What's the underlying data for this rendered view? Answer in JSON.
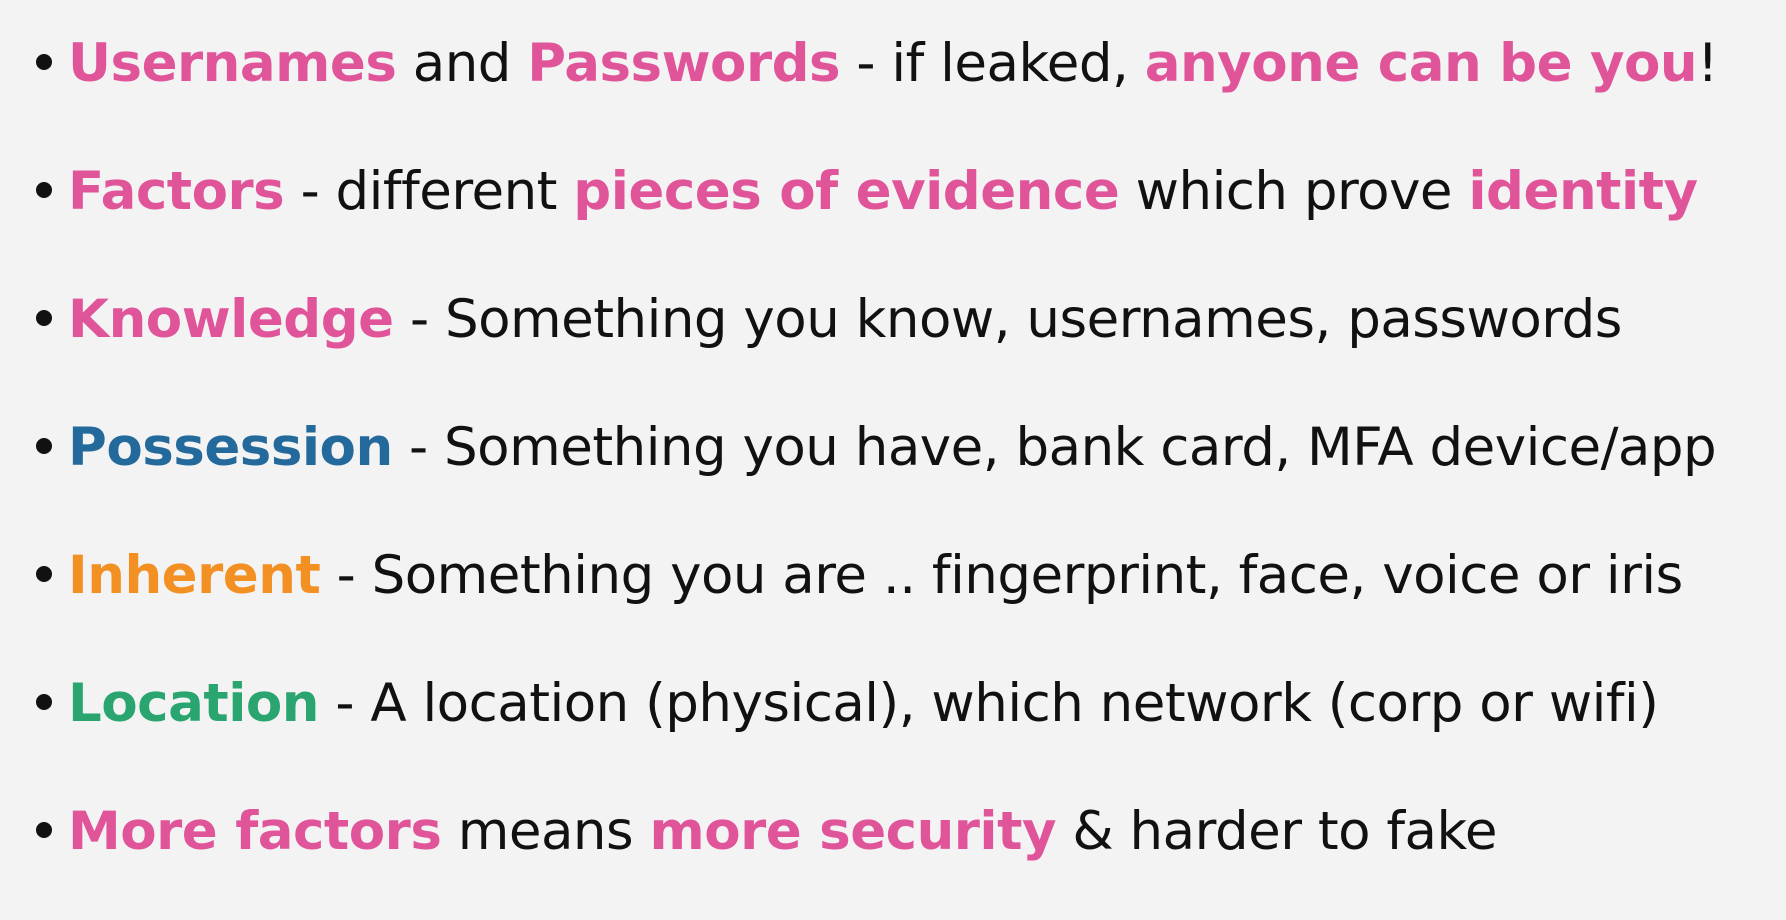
{
  "colors": {
    "background": "#f3f3f3",
    "text": "#111111",
    "pink": "#e0559a",
    "blue": "#23699b",
    "orange": "#f39023",
    "green": "#2aa570"
  },
  "bullets": [
    {
      "segments": [
        {
          "text": "Usernames",
          "style": "pink"
        },
        {
          "text": " and ",
          "style": "plain"
        },
        {
          "text": "Passwords",
          "style": "pink"
        },
        {
          "text": " - if leaked, ",
          "style": "plain"
        },
        {
          "text": "anyone can be you",
          "style": "pink"
        },
        {
          "text": "!",
          "style": "plain"
        }
      ]
    },
    {
      "segments": [
        {
          "text": "Factors",
          "style": "pink"
        },
        {
          "text": " - different ",
          "style": "plain"
        },
        {
          "text": "pieces of evidence",
          "style": "pink"
        },
        {
          "text": " which prove ",
          "style": "plain"
        },
        {
          "text": "identity",
          "style": "pink"
        }
      ]
    },
    {
      "segments": [
        {
          "text": "Knowledge",
          "style": "pink"
        },
        {
          "text": " - Something you know, usernames, passwords",
          "style": "plain"
        }
      ]
    },
    {
      "segments": [
        {
          "text": "Possession",
          "style": "blue"
        },
        {
          "text": " - Something you have, bank card, MFA device/app",
          "style": "plain"
        }
      ]
    },
    {
      "segments": [
        {
          "text": "Inherent",
          "style": "orange"
        },
        {
          "text": " - Something you are .. fingerprint, face, voice or iris",
          "style": "plain"
        }
      ]
    },
    {
      "segments": [
        {
          "text": "Location",
          "style": "green"
        },
        {
          "text": " - A location (physical), which network (corp or wifi)",
          "style": "plain"
        }
      ]
    },
    {
      "segments": [
        {
          "text": "More factors",
          "style": "pink"
        },
        {
          "text": " means ",
          "style": "plain"
        },
        {
          "text": "more security",
          "style": "pink"
        },
        {
          "text": " & harder to fake",
          "style": "plain"
        }
      ]
    }
  ]
}
